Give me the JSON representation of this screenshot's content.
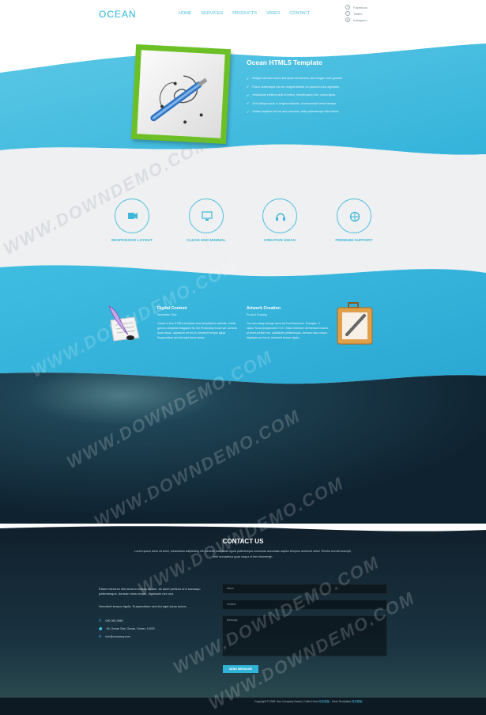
{
  "header": {
    "logo": "OCEAN",
    "nav": [
      "HOME",
      "SERVICES",
      "PRODUCTS",
      "VIDEO",
      "CONTACT"
    ],
    "social": [
      {
        "icon": "facebook-icon",
        "label": "Facebook"
      },
      {
        "icon": "twitter-icon",
        "label": "Twitter"
      },
      {
        "icon": "instagram-icon",
        "label": "Instagram"
      }
    ]
  },
  "hero": {
    "title": "Ocean HTML5 Template",
    "bullets": [
      "Integer interdum lorem sed quam fermentum, sed congue nunc gravida.",
      "Fusce scelerisque est non magna blandit, eu placerat nunc dignissim.",
      "Vestibulum eleifend ante id metus, blandit ipsum nec, varius ligula.",
      "Sed tristique justo in magna vulputate, at elementum lectus tempor.",
      "Nullam dapibus nisi vel arcu euismod, vitae pellentesque felis finibus."
    ]
  },
  "features": [
    {
      "icon": "video-camera-icon",
      "label": "RESPONSIVE LAYOUT"
    },
    {
      "icon": "monitor-icon",
      "label": "CLEAN AND MINIMAL"
    },
    {
      "icon": "headphones-icon",
      "label": "CREATIVE IDEAS"
    },
    {
      "icon": "globe-icon",
      "label": "PREMIUM SUPPORT"
    }
  ],
  "content": {
    "left": {
      "title": "Digital Content",
      "subtitle": "Newsletter Task",
      "text": "Ocean is free HTML5 template from templatemo website. Credit goes to Unsplash Magazine for the Photoshop brush set. Aenean risus neque, dignissim vel leo in, hendrerit tempor ligula. Suspendisse sed dui eget lacus luctus."
    },
    "right": {
      "title": "Artwork Creation",
      "subtitle": "Product Drawing",
      "text": "You can easily change icons by Font Awesome. Example: <i class=\"fa fa-headphones\"></i>. Etiam interdum elementum mauris, at amet pretium est, sollicitudin pellentesque. Aenean risus neque, dignissim vel leo in, hendrerit tempor ligula."
    }
  },
  "contact": {
    "title": "CONTACT US",
    "description": "Lorem ipsum dolor sit amet, consectetur adipisicing elit. Aenean sollicitudin ligula pellentesque commodo accumsan sapien tempore deserunt dolor! Tenetur eveniet suscipit, velit accusamus quae neque ut fore doloremgh.",
    "left_text_1": "Etiam interdum elementum massa ornare, sit amet pretium orci sociosqu pellentesque. Aenean risus neque, dignissim nec orci.",
    "left_text_2": "Hendrerit tempor ligula. Suspendisse sed dui eget lacus luctus.",
    "phone": "090-080-0660",
    "address": "99, Ocean Star, Ocean, Ocean, 10200",
    "email": "info@company.com",
    "fields": {
      "name": "Name",
      "subject": "Subject",
      "message": "Message"
    },
    "send": "SEND MESSAGE"
  },
  "footer": {
    "copy": "Copyright © 2084 Your Company Name | Collect from",
    "link1": "网页模板",
    "middle": "- More Templates",
    "link2": "网页模板"
  },
  "watermark": "WWW.DOWNDEMO.COM",
  "colors": {
    "accent": "#2fb4d8",
    "dark": "#0f2230",
    "green_frame": "#6cc026"
  }
}
